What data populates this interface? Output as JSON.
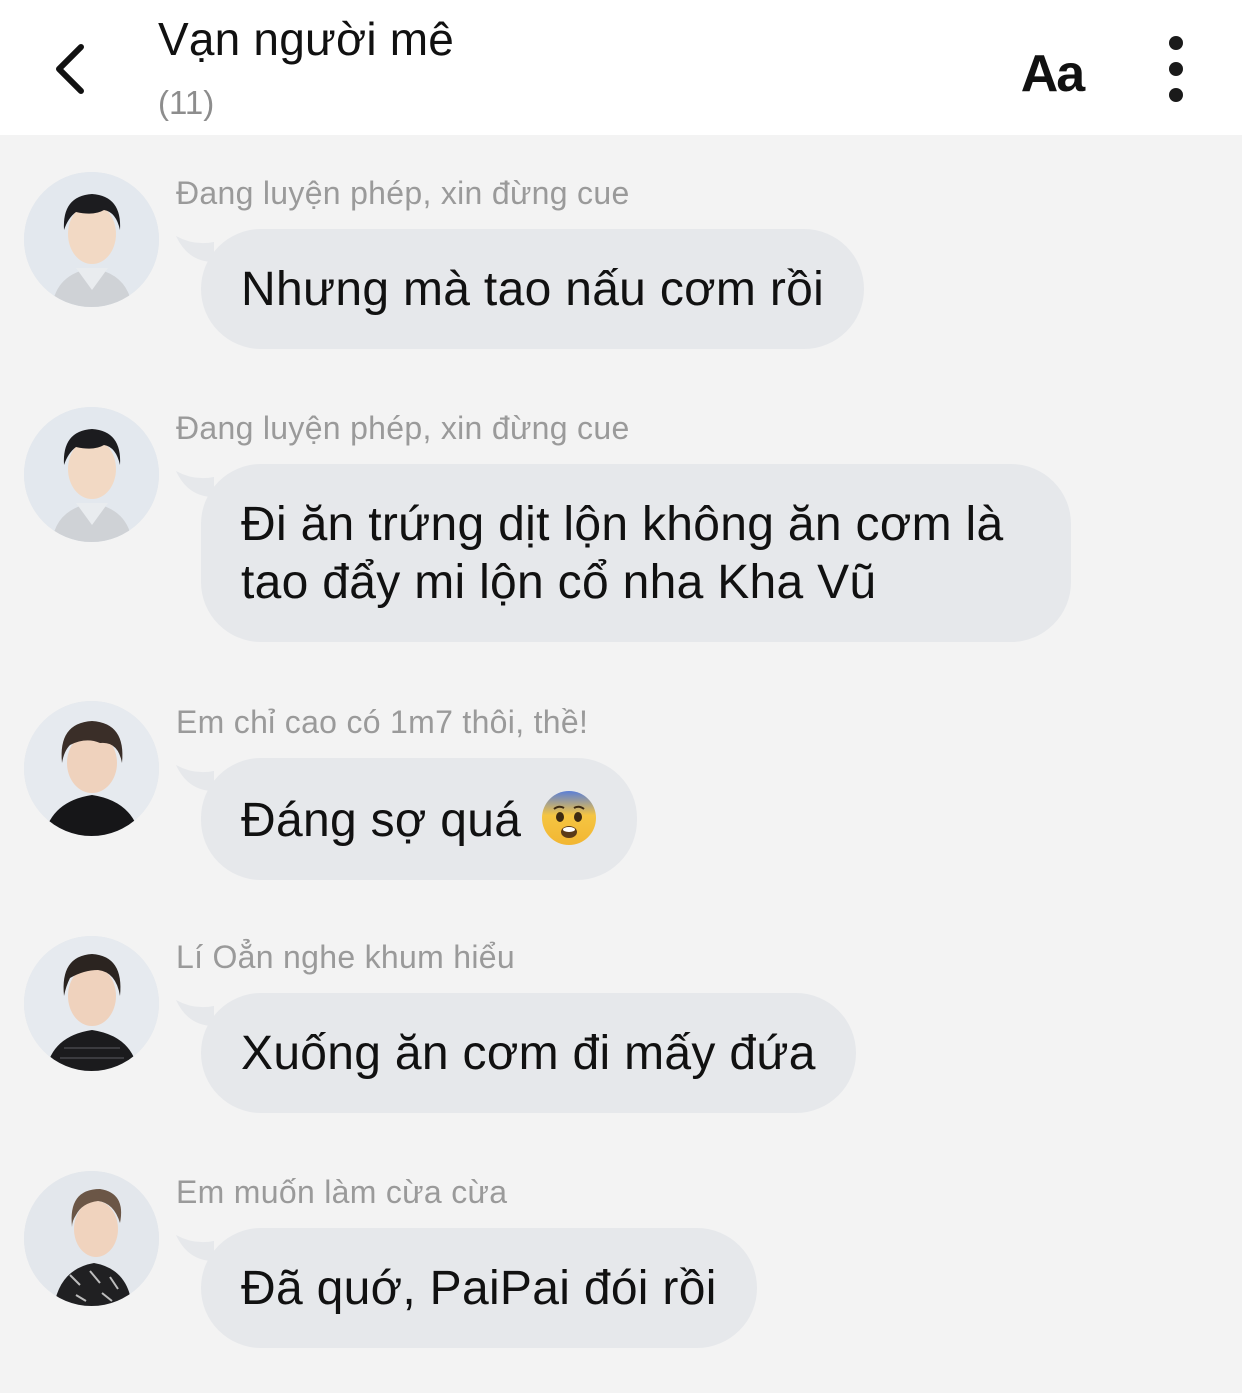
{
  "header": {
    "title": "Vạn người mê",
    "member_count": "(11)",
    "font_button_label": "Aa"
  },
  "messages": [
    {
      "sender": "Đang luyện phép, xin đừng cue",
      "text": "Nhưng mà tao nấu cơm rồi",
      "avatar": "avatar-photo-boy-striped-shirt"
    },
    {
      "sender": "Đang luyện phép, xin đừng cue",
      "text": "Đi ăn trứng dịt lộn không ăn cơm là tao đẩy mi lộn cổ nha Kha Vũ",
      "avatar": "avatar-photo-boy-striped-shirt"
    },
    {
      "sender": "Em chỉ cao có 1m7 thôi, thề!",
      "text": "Đáng sợ quá",
      "emoji": "fearful-face-emoji",
      "avatar": "avatar-photo-boy-black-shirt"
    },
    {
      "sender": "Lí Oẳn nghe khum hiểu",
      "text": "Xuống ăn cơm đi mấy đứa",
      "avatar": "avatar-photo-boy-lace-shirt"
    },
    {
      "sender": "Em muốn làm cừa cừa",
      "text": "Đã quớ, PaiPai đói rồi",
      "avatar": "avatar-photo-boy-patterned-shirt"
    }
  ],
  "colors": {
    "header_bg": "#ffffff",
    "chat_bg": "#f3f3f3",
    "bubble_bg": "#e6e8eb",
    "sender_text": "#9a9a9a",
    "message_text": "#111111"
  }
}
